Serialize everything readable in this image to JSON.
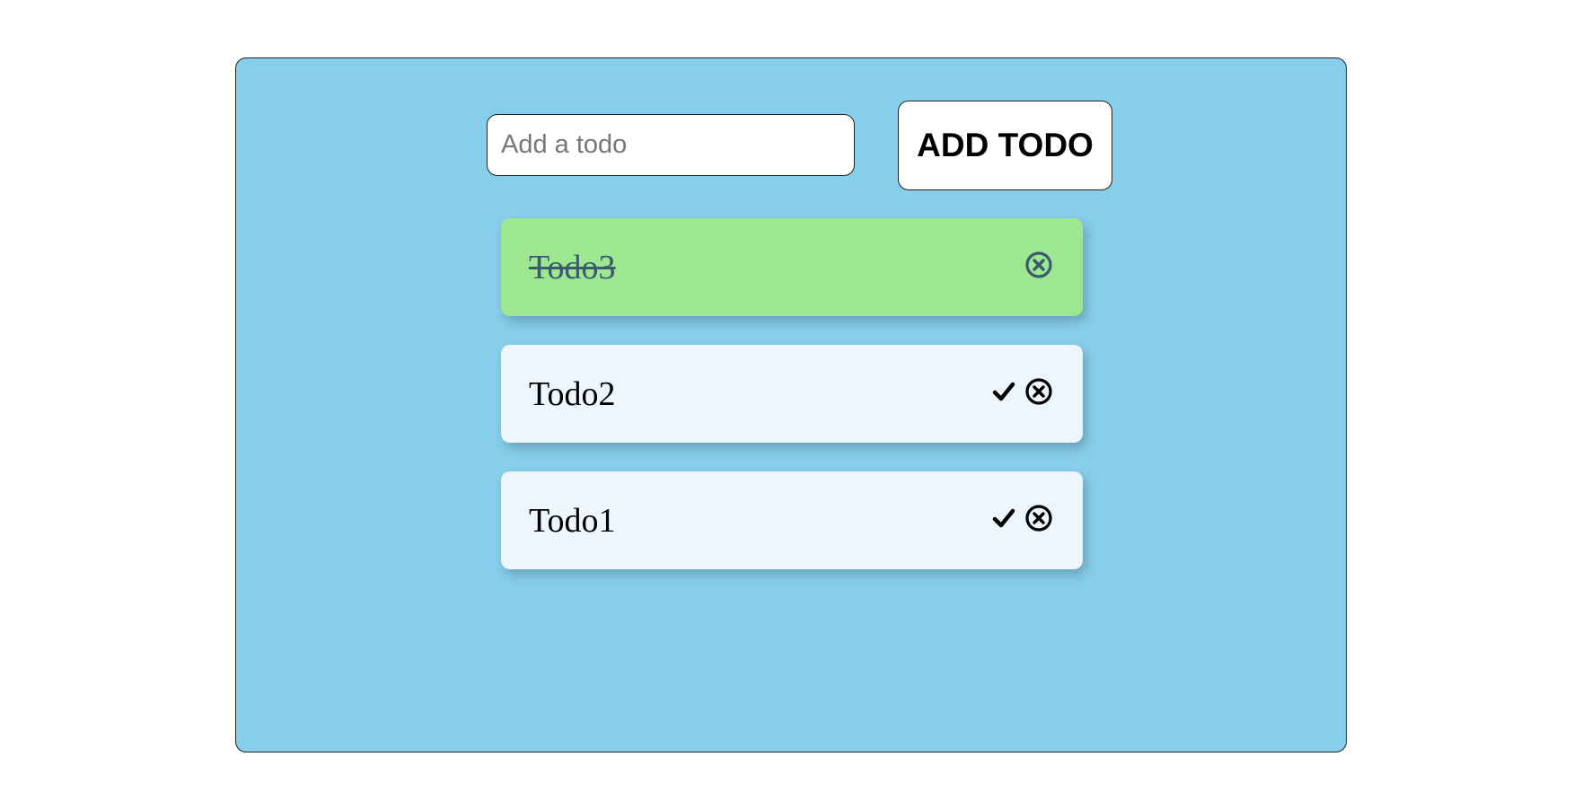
{
  "colors": {
    "panel_background": "#87ceeb",
    "completed_item": "#9de790",
    "pending_item": "#eef6fd",
    "completed_icon": "#3a5a6e",
    "pending_icon": "#000000"
  },
  "add_form": {
    "input_value": "",
    "input_placeholder": "Add a todo",
    "button_label": "ADD TODO"
  },
  "todos": [
    {
      "text": "Todo3",
      "completed": true,
      "icons": [
        "close-circle-icon"
      ]
    },
    {
      "text": "Todo2",
      "completed": false,
      "icons": [
        "check-icon",
        "close-circle-icon"
      ]
    },
    {
      "text": "Todo1",
      "completed": false,
      "icons": [
        "check-icon",
        "close-circle-icon"
      ]
    }
  ]
}
